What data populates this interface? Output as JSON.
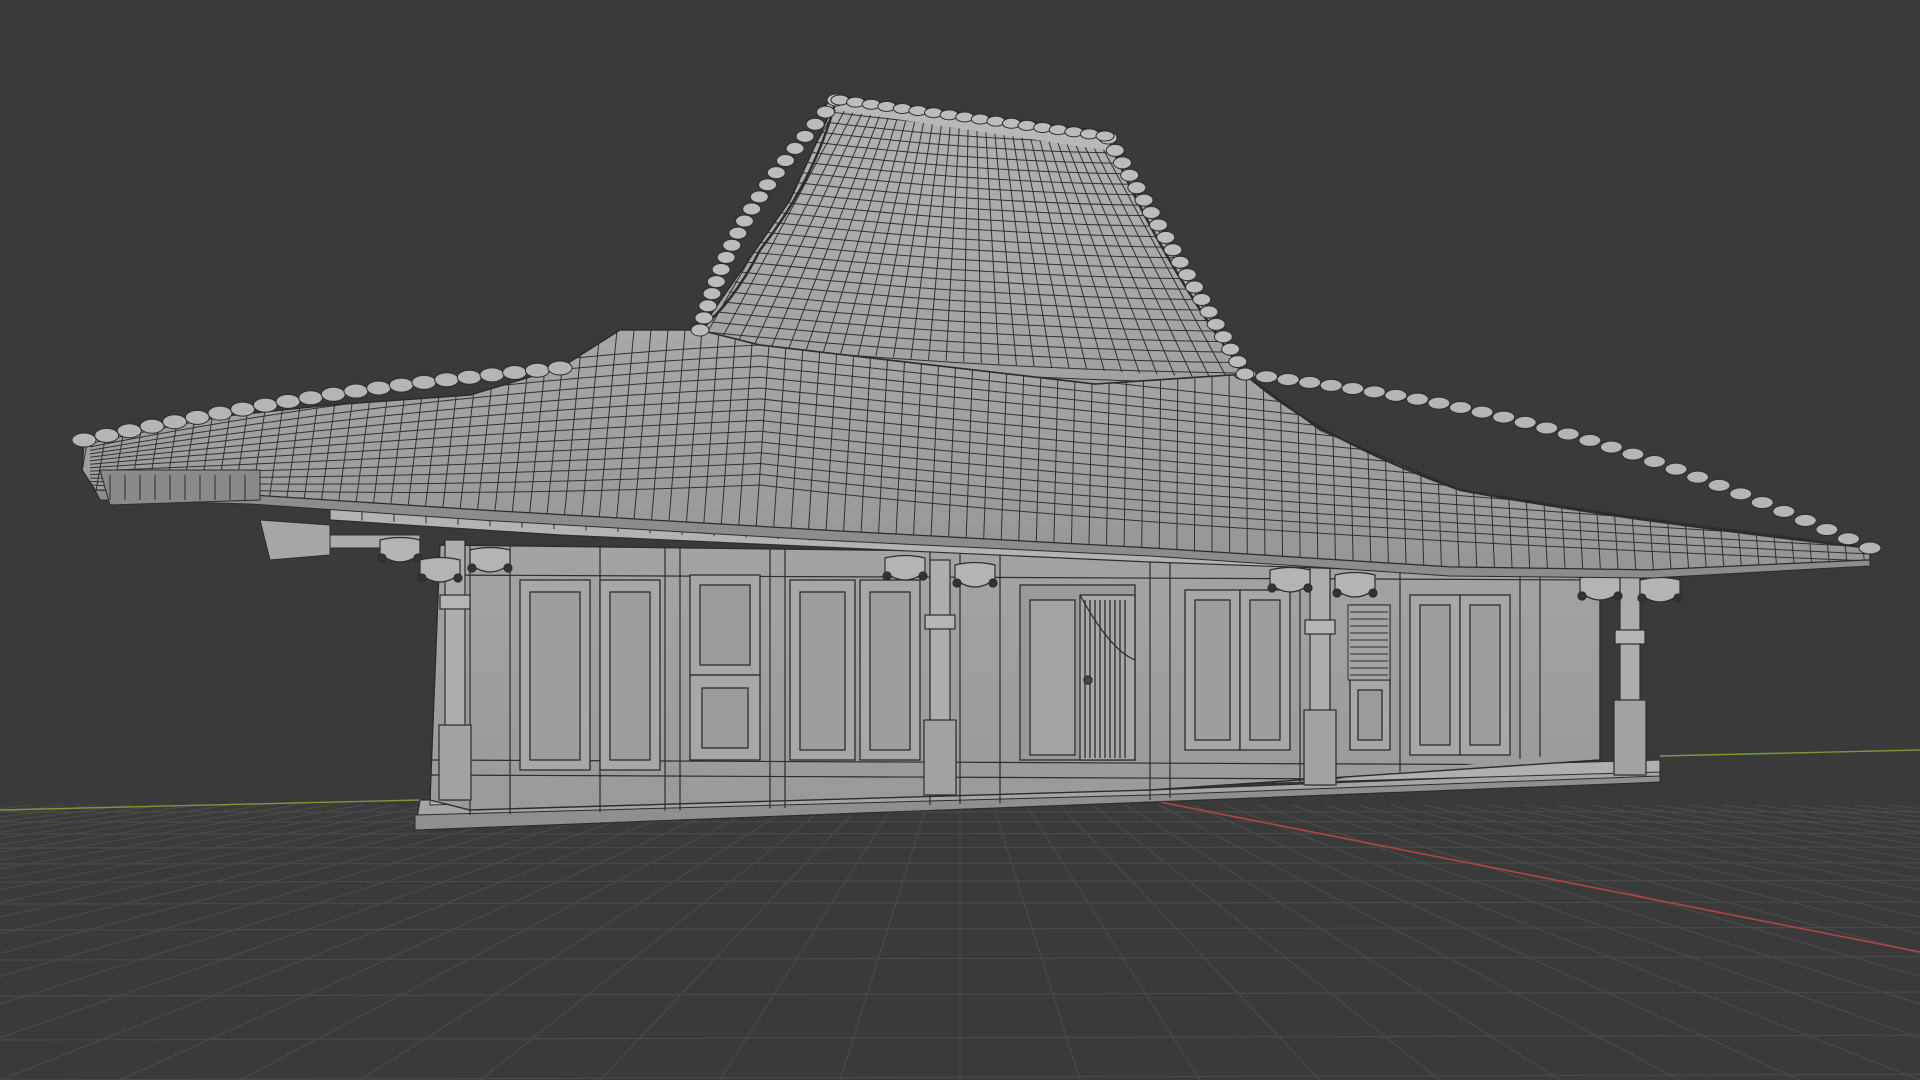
{
  "viewport": {
    "background_color": "#3a3a3a",
    "grid_line_color": "#4a4a4a",
    "x_axis_color": "#b44545",
    "y_axis_color": "#7a9a3a"
  },
  "model": {
    "object": "javanese-joglo-house",
    "shading": "solid",
    "wireframe_overlay": true,
    "base_color": "#a9a9a9",
    "edge_color": "#2c2c2c"
  }
}
